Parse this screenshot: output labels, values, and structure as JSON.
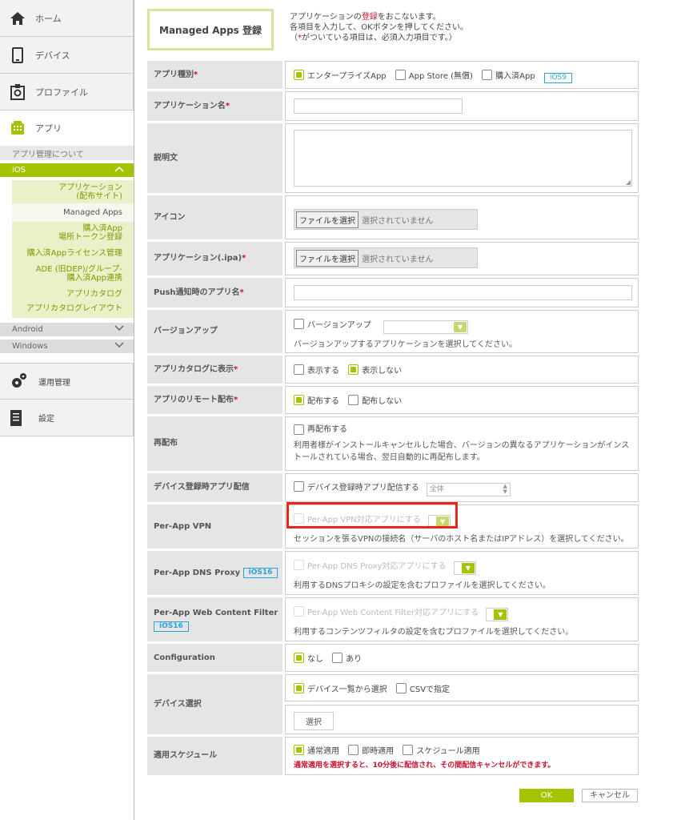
{
  "sidebar": {
    "home": "ホーム",
    "device": "デバイス",
    "profile": "プロファイル",
    "app": "アプリ",
    "about": "アプリ管理について",
    "ios": "iOS",
    "ios_items": [
      "アプリケーション\n(配布サイト)",
      "Managed Apps",
      "購入済App\n場所トークン登録",
      "購入済Appライセンス管理",
      "ADE (旧DEP)/グループ-\n購入済App連携",
      "アプリカタログ",
      "アプリカタログレイアウト"
    ],
    "android": "Android",
    "windows": "Windows",
    "operations": "運用管理",
    "settings": "設定"
  },
  "header": {
    "title": "Managed Apps 登録",
    "intro1a": "アプリケーションの",
    "intro1b": "登録",
    "intro1c": "をおこないます。",
    "intro2": "各項目を入力して、OKボタンを押してください。",
    "intro3a": "（",
    "intro3b": "*",
    "intro3c": "がついている項目は、必須入力項目です。）"
  },
  "form": {
    "app_type": {
      "label": "アプリ種別",
      "req": "*",
      "opt1": "エンタープライズApp",
      "opt2": "App Store (無償)",
      "opt3": "購入済App",
      "badge": "iOS9"
    },
    "app_name": {
      "label": "アプリケーション名",
      "req": "*"
    },
    "description": {
      "label": "説明文"
    },
    "icon": {
      "label": "アイコン",
      "button": "ファイルを選択",
      "status": "選択されていません"
    },
    "ipa": {
      "label": "アプリケーション(.ipa)",
      "req": "*",
      "button": "ファイルを選択",
      "status": "選択されていません"
    },
    "push_name": {
      "label": "Push通知時のアプリ名",
      "req": "*"
    },
    "version": {
      "label": "バージョンアップ",
      "checkbox": "バージョンアップ",
      "desc": "バージョンアップするアプリケーションを選択してください。"
    },
    "catalog": {
      "label": "アプリカタログに表示",
      "req": "*",
      "opt1": "表示する",
      "opt2": "表示しない"
    },
    "remote": {
      "label": "アプリのリモート配布",
      "req": "*",
      "opt1": "配布する",
      "opt2": "配布しない"
    },
    "redeploy": {
      "label": "再配布",
      "checkbox": "再配布する",
      "desc": "利用者様がインストールキャンセルした場合、バージョンの異なるアプリケーションがインストールされている場合、翌日自動的に再配布します。"
    },
    "enroll": {
      "label": "デバイス登録時アプリ配信",
      "checkbox": "デバイス登録時アプリ配信する",
      "select": "全体"
    },
    "vpn": {
      "label": "Per-App VPN",
      "checkbox": "Per-App VPN対応アプリにする",
      "desc": "セッションを張るVPNの接続名（サーバのホスト名またはIPアドレス）を選択してください。"
    },
    "dns": {
      "label": "Per-App DNS Proxy",
      "badge": "iOS16",
      "checkbox": "Per-App DNS Proxy対応アプリにする",
      "desc": "利用するDNSプロキシの設定を含むプロファイルを選択してください。"
    },
    "filter": {
      "label": "Per-App Web Content Filter",
      "badge": "iOS16",
      "checkbox": "Per-App Web Content Filter対応アプリにする",
      "desc": "利用するコンテンツフィルタの設定を含むプロファイルを選択してください。"
    },
    "config": {
      "label": "Configuration",
      "opt1": "なし",
      "opt2": "あり"
    },
    "device_select": {
      "label": "デバイス選択",
      "opt1": "デバイス一覧から選択",
      "opt2": "CSVで指定",
      "button": "選択"
    },
    "schedule": {
      "label": "適用スケジュール",
      "opt1": "通常適用",
      "opt2": "即時適用",
      "opt3": "スケジュール適用",
      "note": "通常適用を選択すると、10分後に配信され、その間配信キャンセルができます。"
    }
  },
  "actions": {
    "ok": "OK",
    "cancel": "キャンセル"
  }
}
